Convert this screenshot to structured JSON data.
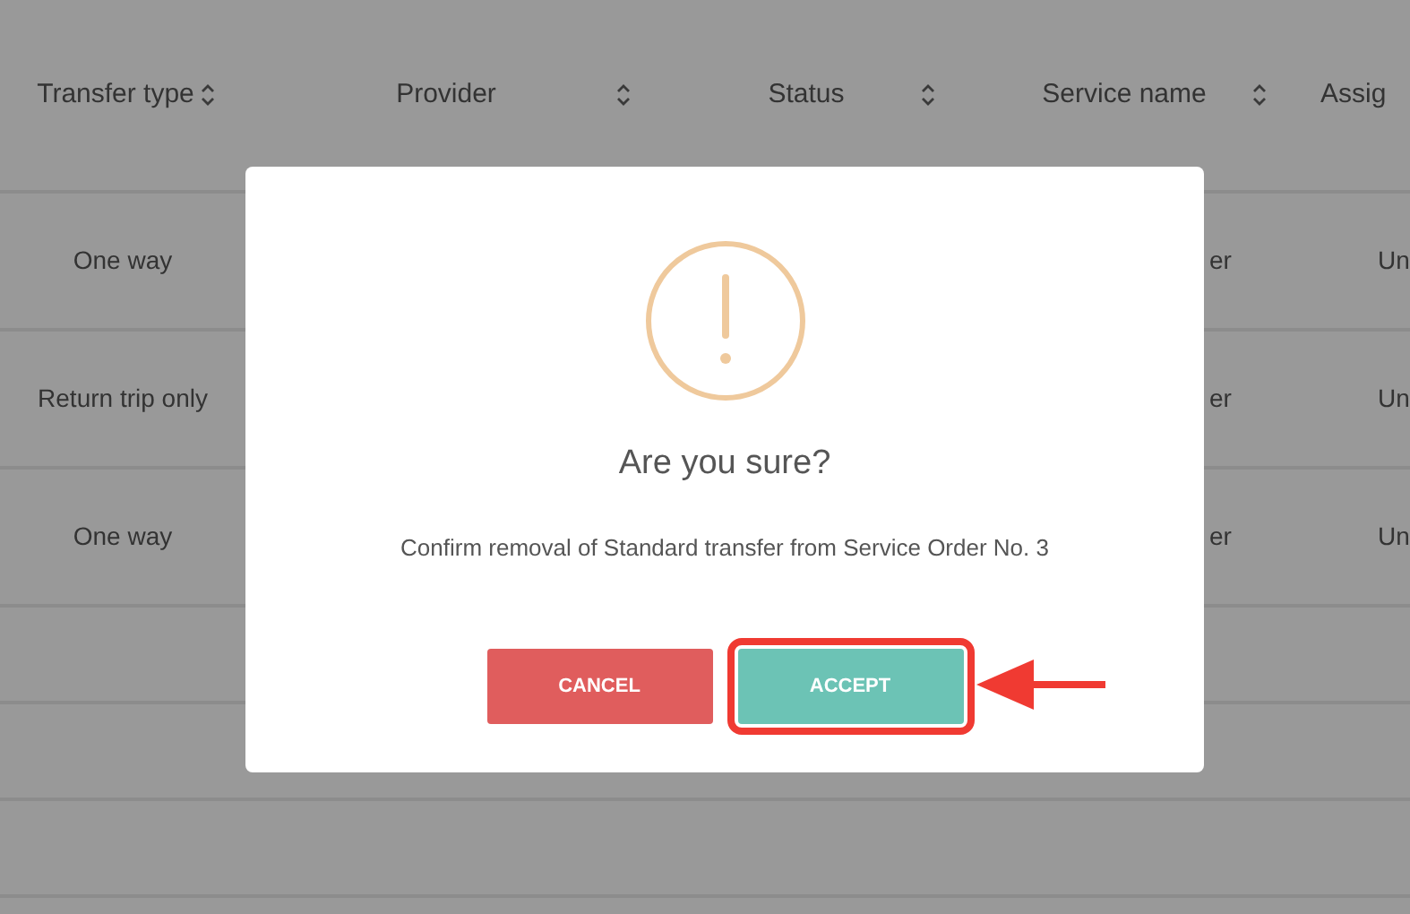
{
  "table": {
    "columns": [
      {
        "label": "Transfer type"
      },
      {
        "label": "Provider"
      },
      {
        "label": "Status"
      },
      {
        "label": "Service name"
      },
      {
        "label": "Assig"
      }
    ],
    "rows": [
      {
        "transfer_type": "One way",
        "service_name": "er",
        "column_5": "Un"
      },
      {
        "transfer_type": "Return trip only",
        "service_name": "er",
        "column_5": "Un"
      },
      {
        "transfer_type": "One way",
        "service_name": "er",
        "column_5": "Un"
      },
      {},
      {},
      {}
    ]
  },
  "dialog": {
    "title": "Are you sure?",
    "message": "Confirm removal of Standard transfer from Service Order No. 3",
    "buttons": [
      {
        "label": "CANCEL",
        "kind": "cancel",
        "highlighted": false
      },
      {
        "label": "ACCEPT",
        "kind": "accept",
        "highlighted": true
      }
    ]
  }
}
